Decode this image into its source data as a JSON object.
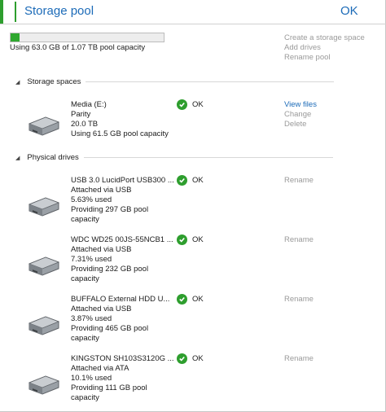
{
  "header": {
    "title": "Storage pool",
    "ok": "OK"
  },
  "pool": {
    "used_fraction": 0.059,
    "capacity_text": "Using 63.0 GB of 1.07 TB pool capacity",
    "links": [
      "Create a storage space",
      "Add drives",
      "Rename pool"
    ]
  },
  "storage_spaces": {
    "label": "Storage spaces",
    "items": [
      {
        "lines": [
          "Media (E:)",
          "Parity",
          "20.0 TB",
          "Using 61.5 GB pool capacity"
        ],
        "status": "OK",
        "links": [
          "View files",
          "Change",
          "Delete"
        ]
      }
    ]
  },
  "physical_drives": {
    "label": "Physical drives",
    "items": [
      {
        "lines": [
          "USB 3.0 LucidPort USB300 ...",
          "Attached via USB",
          "5.63% used",
          "Providing 297 GB pool",
          "capacity"
        ],
        "status": "OK",
        "action": "Rename"
      },
      {
        "lines": [
          "WDC WD25 00JS-55NCB1 ...",
          "Attached via USB",
          "7.31% used",
          "Providing 232 GB pool",
          "capacity"
        ],
        "status": "OK",
        "action": "Rename"
      },
      {
        "lines": [
          "BUFFALO External HDD U...",
          "Attached via USB",
          "3.87% used",
          "Providing 465 GB pool",
          "capacity"
        ],
        "status": "OK",
        "action": "Rename"
      },
      {
        "lines": [
          "KINGSTON SH103S3120G ...",
          "Attached via ATA",
          "10.1% used",
          "Providing 111 GB pool",
          "capacity"
        ],
        "status": "OK",
        "action": "Rename"
      }
    ]
  },
  "colors": {
    "accent": "#2e9e2e",
    "link": "#1c6bb8",
    "disabled_link": "#9a9a9a"
  },
  "icons": {
    "drive": "hard-drive-icon",
    "status": "check-circle-icon",
    "expander": "collapse-triangle-icon"
  }
}
